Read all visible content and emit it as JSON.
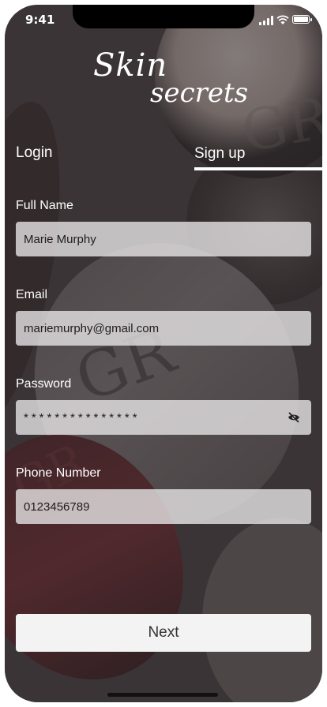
{
  "status_bar": {
    "time": "9:41"
  },
  "logo": {
    "line1": "Skin",
    "line2": "secrets",
    "trademark": "™"
  },
  "tabs": {
    "login": "Login",
    "signup": "Sign up",
    "active": "signup"
  },
  "form": {
    "full_name": {
      "label": "Full Name",
      "value": "Marie Murphy"
    },
    "email": {
      "label": "Email",
      "value": "mariemurphy@gmail.com"
    },
    "password": {
      "label": "Password",
      "value": "***************"
    },
    "phone": {
      "label": "Phone Number",
      "value": "0123456789"
    }
  },
  "next_button": {
    "label": "Next"
  },
  "icons": {
    "password_toggle": "eye-slash-icon",
    "signal": "cellular-signal-icon",
    "wifi": "wifi-icon",
    "battery": "battery-icon"
  },
  "colors": {
    "overlay": "#2d282a",
    "input_bg": "#e6e4e5",
    "button_bg": "#f3f3f3",
    "text": "#ffffff"
  }
}
